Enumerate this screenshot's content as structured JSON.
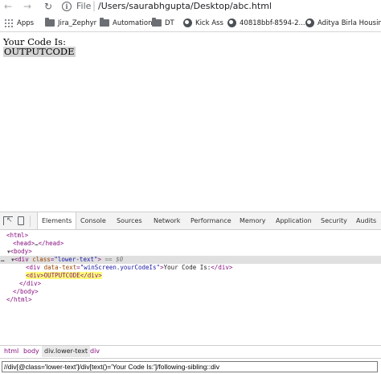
{
  "browser": {
    "scheme_label": "File",
    "url": "/Users/saurabhgupta/Desktop/abc.html"
  },
  "bookmarks": [
    {
      "label": "Apps",
      "icon": "apps-grid-icon"
    },
    {
      "label": "Jira_Zephyr",
      "icon": "folder-icon"
    },
    {
      "label": "Automation",
      "icon": "folder-icon"
    },
    {
      "label": "DT",
      "icon": "folder-icon"
    },
    {
      "label": "Kick Ass",
      "icon": "globe-icon"
    },
    {
      "label": "40818bbf-8594-2...",
      "icon": "globe-icon"
    },
    {
      "label": "Aditya Birla Housin...",
      "icon": "globe-icon"
    }
  ],
  "page": {
    "code_label": "Your Code Is:",
    "code_value": "OUTPUTCODE"
  },
  "devtools": {
    "tabs": [
      "Elements",
      "Console",
      "Sources",
      "Network",
      "Performance",
      "Memory",
      "Application",
      "Security",
      "Audits"
    ],
    "active_tab": "Elements",
    "dom": {
      "html_open": "<html>",
      "head": "<head>",
      "head_close": "</head>",
      "body_open": "<body>",
      "div_tag": "div",
      "div_attr": "class",
      "div_attr_val": "\"lower-text\"",
      "selected_marker": "== $0",
      "inner_div_tag": "div",
      "inner_div_attr": "data-text",
      "inner_div_attr_val": "\"winScreen.yourCodeIs\"",
      "inner_div_text": "Your Code Is:",
      "inner_div_close": "</div>",
      "highlighted": "<div>OUTPUTCODE</div>",
      "div_close": "</div>",
      "body_close": "</body>",
      "html_close": "</html>"
    },
    "breadcrumbs": [
      "html",
      "body",
      "div.lower-text",
      "div"
    ],
    "active_breadcrumb": "div.lower-text",
    "xpath_query": "//div[@class='lower-text']/div[text()='Your Code Is:']/following-sibling::div"
  }
}
